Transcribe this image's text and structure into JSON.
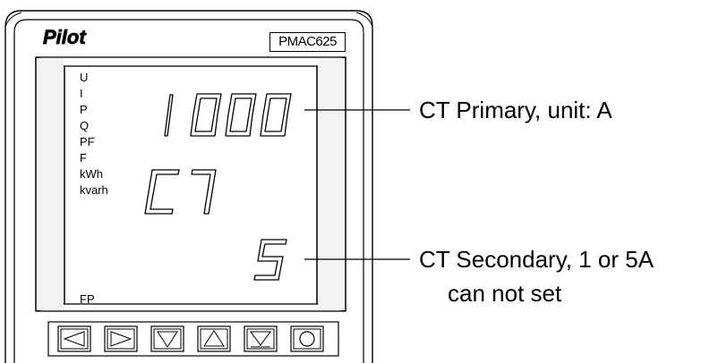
{
  "device": {
    "brand": "Pilot",
    "model": "PMAC625"
  },
  "indicators": [
    "U",
    "I",
    "P",
    "Q",
    "PF",
    "F",
    "kWh",
    "kvarh"
  ],
  "bottom_indicator": "FP",
  "display": {
    "row1": "1000",
    "row2": "C7",
    "row3": "5"
  },
  "callouts": {
    "primary": "CT   Primary,  unit: A",
    "secondary_line1": "CT  Secondary, 1 or 5A",
    "secondary_line2": "can not set"
  },
  "buttons": [
    {
      "name": "left-arrow-button",
      "icon": "left-triangle"
    },
    {
      "name": "right-arrow-button",
      "icon": "right-triangle"
    },
    {
      "name": "down-arrow-button",
      "icon": "down-triangle"
    },
    {
      "name": "up-arrow-button",
      "icon": "up-triangle"
    },
    {
      "name": "enter-button",
      "icon": "down-triangle-underline"
    },
    {
      "name": "ok-button",
      "icon": "circle"
    }
  ]
}
